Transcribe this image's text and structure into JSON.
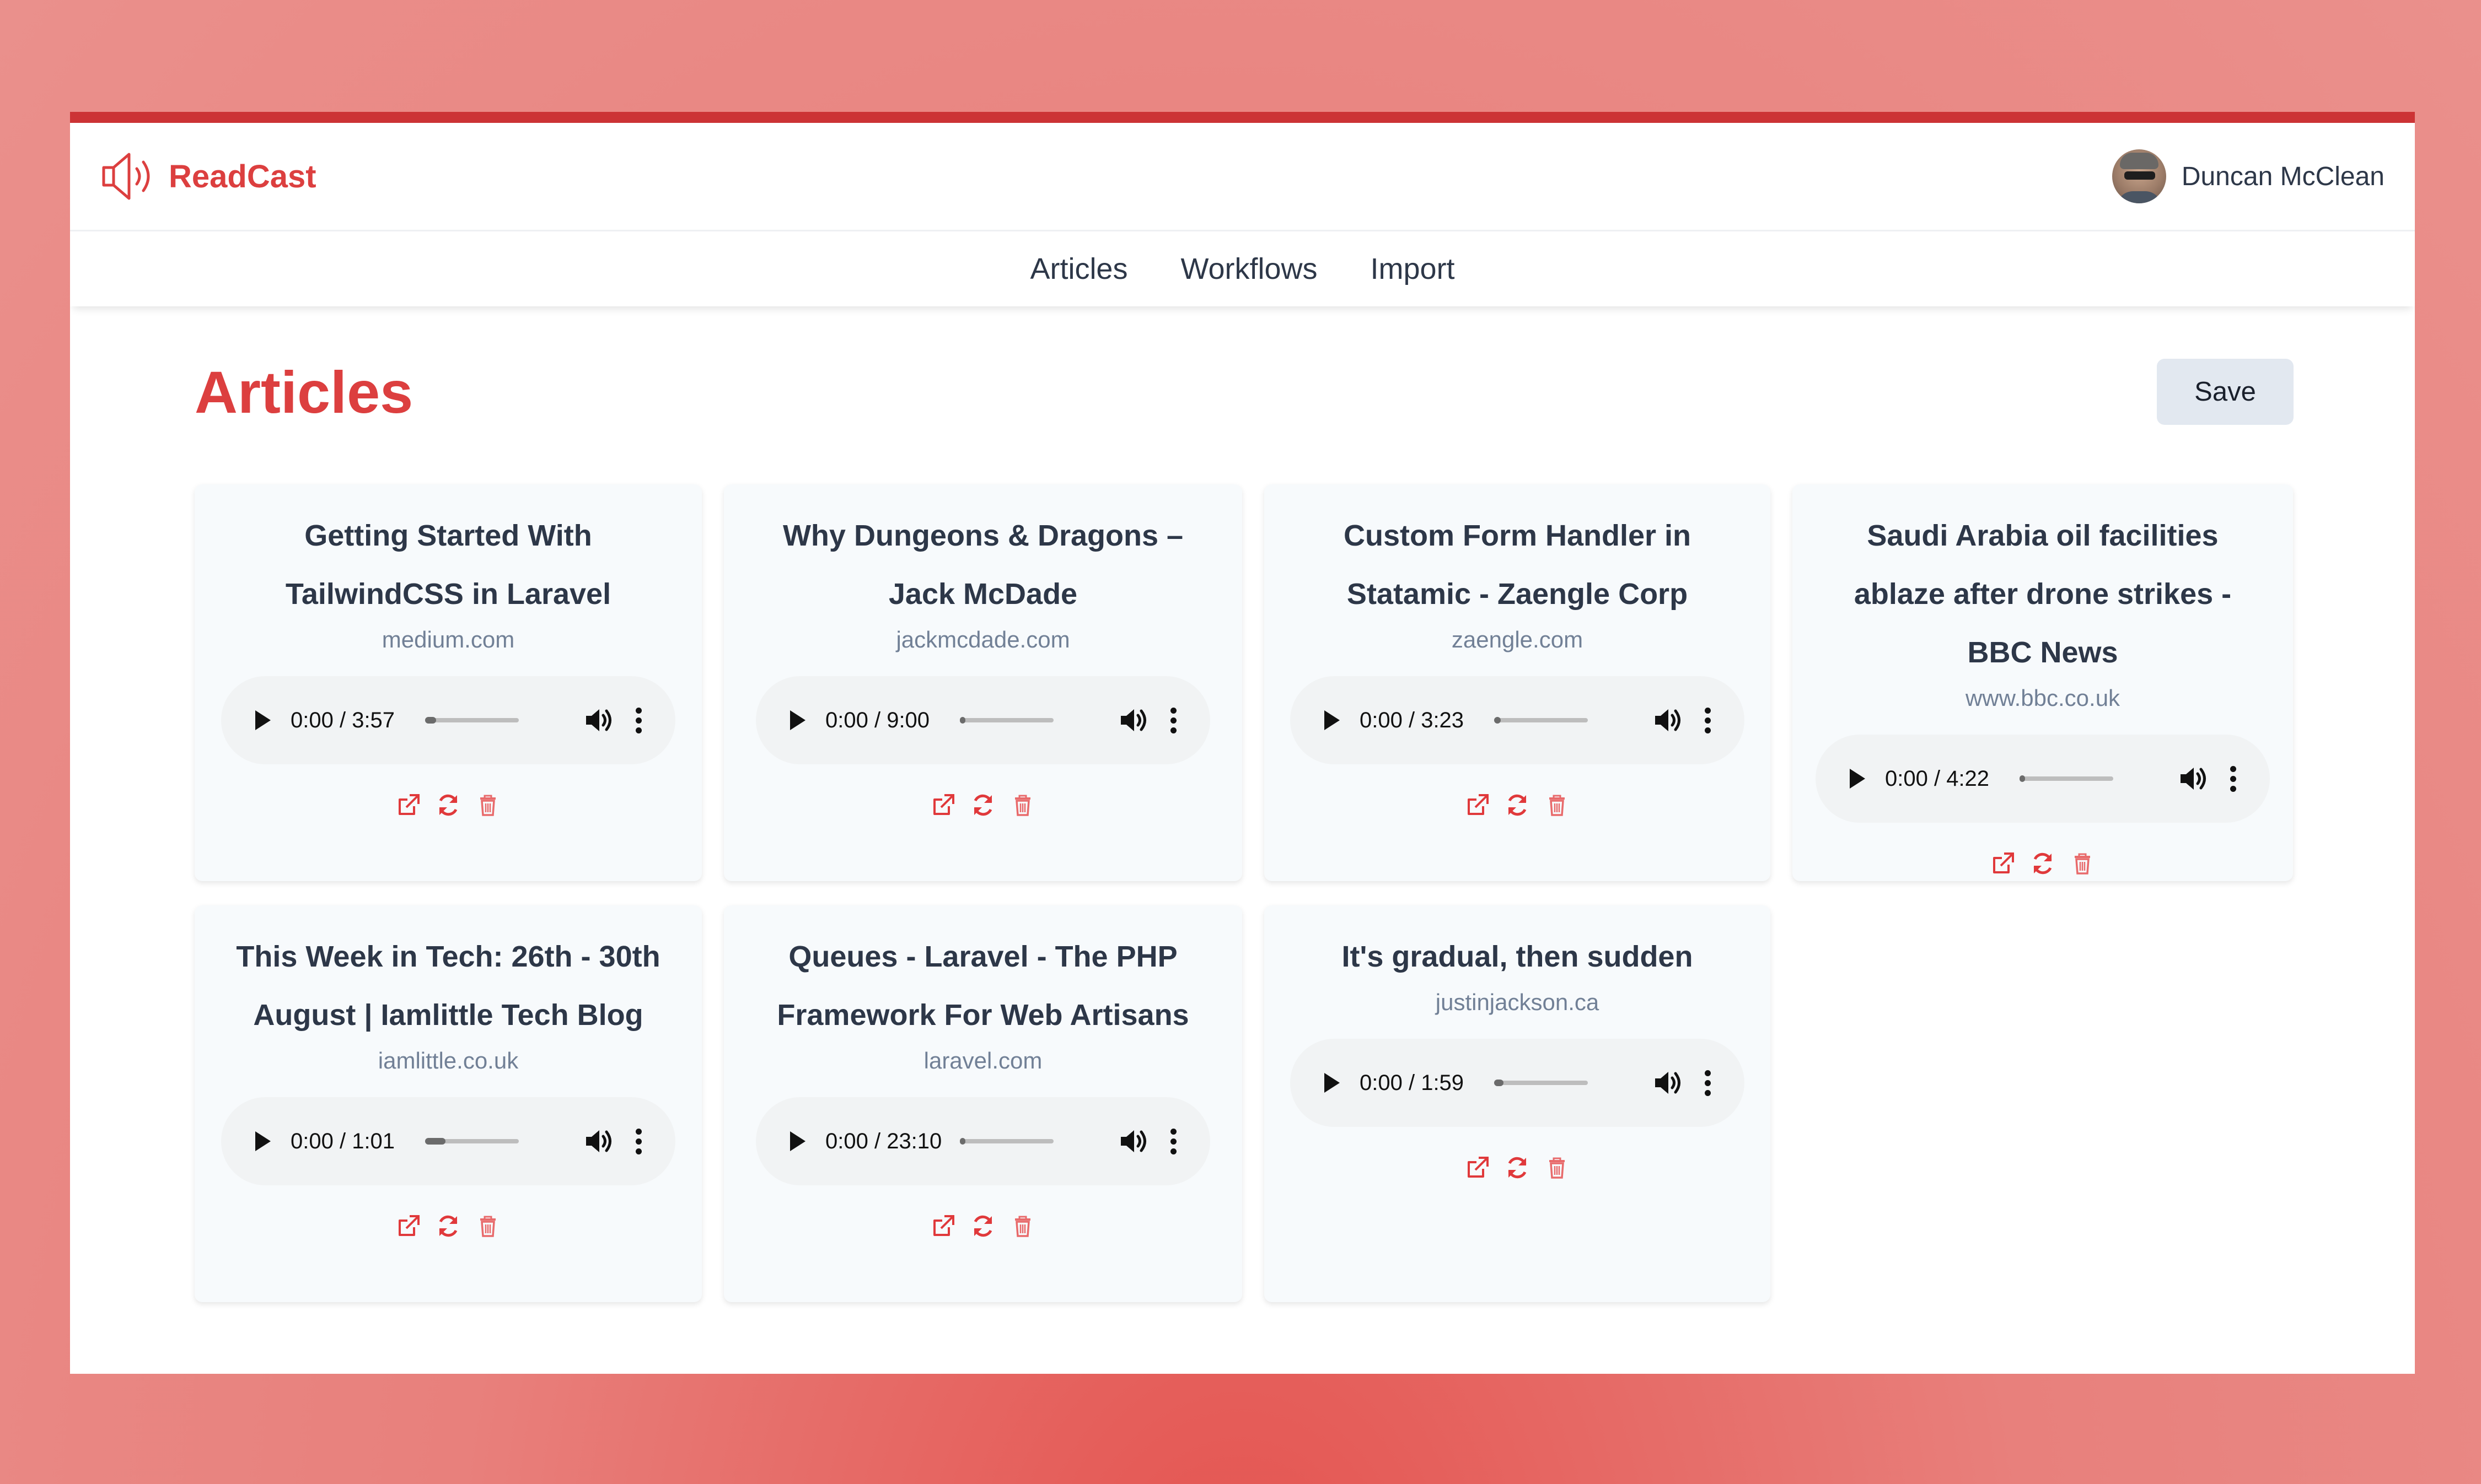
{
  "app": {
    "name": "ReadCast",
    "brand_color": "#dc3f3f",
    "top_border_color": "#cc3335"
  },
  "user": {
    "name": "Duncan McClean"
  },
  "nav": {
    "items": [
      {
        "label": "Articles"
      },
      {
        "label": "Workflows"
      },
      {
        "label": "Import"
      }
    ]
  },
  "page": {
    "title": "Articles",
    "save_label": "Save"
  },
  "icons": {
    "open": "external-link-icon",
    "regenerate": "refresh-icon",
    "delete": "trash-icon",
    "play": "play-icon",
    "volume": "volume-icon",
    "menu": "more-vertical-icon"
  },
  "articles": [
    {
      "title": "Getting Started With TailwindCSS in Laravel",
      "domain": "medium.com",
      "time": "0:00 / 3:57",
      "progress": 0.12
    },
    {
      "title": "Why Dungeons & Dragons – Jack McDade",
      "domain": "jackmcdade.com",
      "time": "0:00 / 9:00",
      "progress": 0.03
    },
    {
      "title": "Custom Form Handler in Statamic - Zaengle Corp",
      "domain": "zaengle.com",
      "time": "0:00 / 3:23",
      "progress": 0.07
    },
    {
      "title": "Saudi Arabia oil facilities ablaze after drone strikes - BBC News",
      "domain": "www.bbc.co.uk",
      "time": "0:00 / 4:22",
      "progress": 0.05
    },
    {
      "title": "This Week in Tech: 26th - 30th August | Iamlittle Tech Blog",
      "domain": "iamlittle.co.uk",
      "time": "0:00 / 1:01",
      "progress": 0.22
    },
    {
      "title": "Queues - Laravel - The PHP Framework For Web Artisans",
      "domain": "laravel.com",
      "time": "0:00 / 23:10",
      "progress": 0.01
    },
    {
      "title": "It's gradual, then sudden",
      "domain": "justinjackson.ca",
      "time": "0:00 / 1:59",
      "progress": 0.1
    }
  ]
}
